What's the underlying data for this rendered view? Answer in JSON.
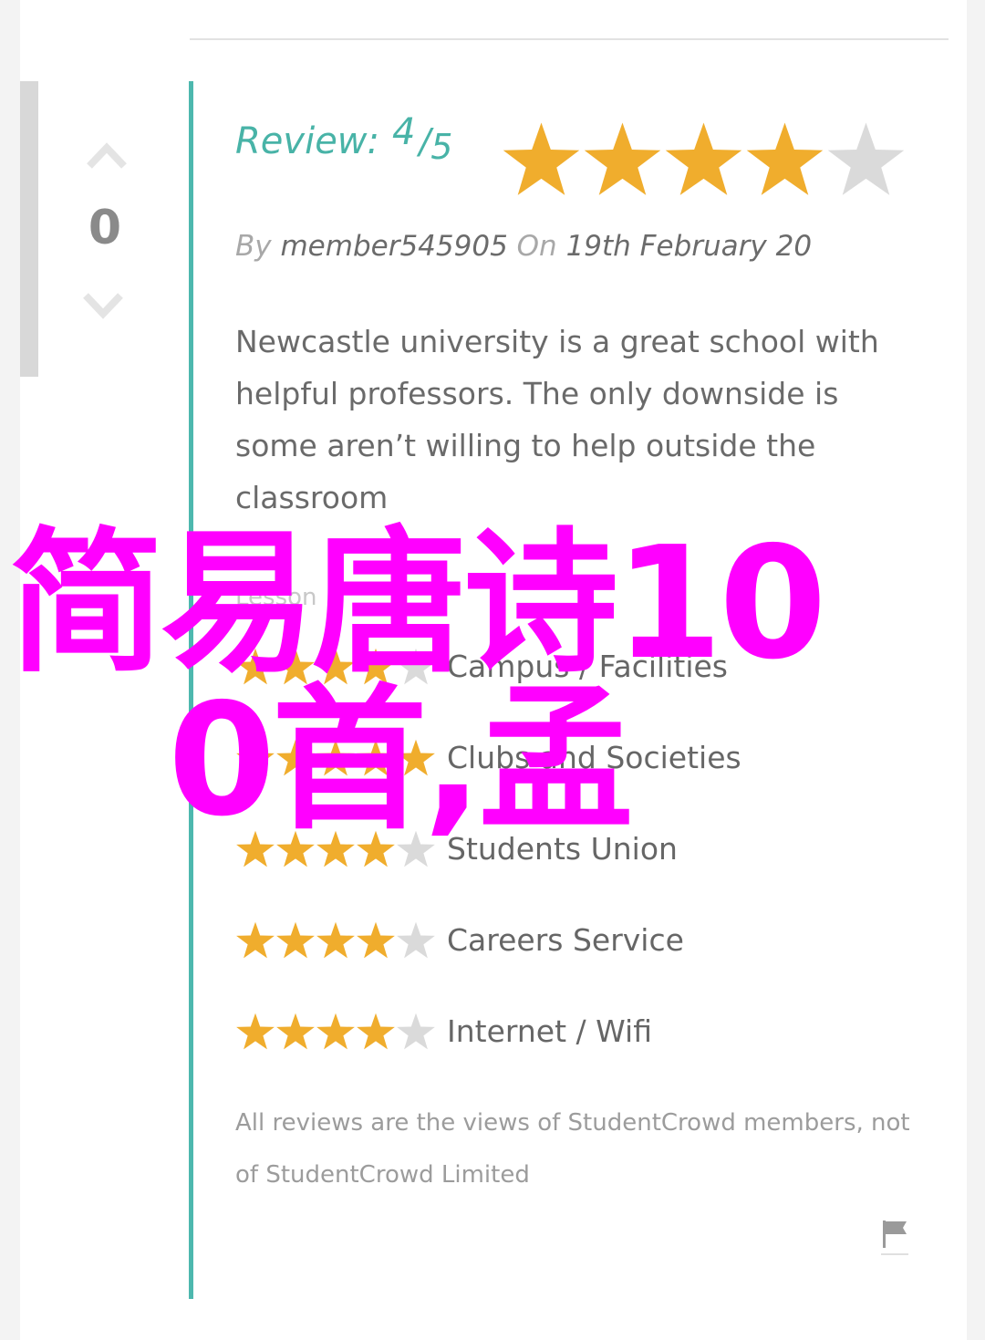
{
  "vote": {
    "count": "0",
    "up_icon": "chevron-up-icon",
    "down_icon": "chevron-down-icon"
  },
  "review": {
    "label": "Review:",
    "score": "4",
    "slash": "/",
    "max": "5",
    "rating": 4,
    "rating_max": 5,
    "by_label": "By",
    "author": "member545905",
    "on_label": "On",
    "date": "19th February 20",
    "body": "Newcastle university is a great school with helpful professors. The only downside is some aren’t willing to help outside the classroom"
  },
  "category_heading": "Lesson",
  "category_ratings": [
    {
      "label": "Campus / Facilities",
      "rating": 4
    },
    {
      "label": "Clubs and Societies",
      "rating": 5
    },
    {
      "label": "Students Union",
      "rating": 4
    },
    {
      "label": "Careers Service",
      "rating": 4
    },
    {
      "label": "Internet / Wifi",
      "rating": 4
    }
  ],
  "disclaimer": "All reviews are the views of StudentCrowd members, not of StudentCrowd Limited",
  "flag": {
    "icon": "flag-icon"
  },
  "overlay": {
    "line1": "简易唐诗10",
    "line2": "0首,孟"
  },
  "colors": {
    "star_filled": "#f0ad2d",
    "star_empty": "#dadada",
    "accent_teal": "#4db8ae",
    "overlay_magenta": "#ff00ff"
  }
}
